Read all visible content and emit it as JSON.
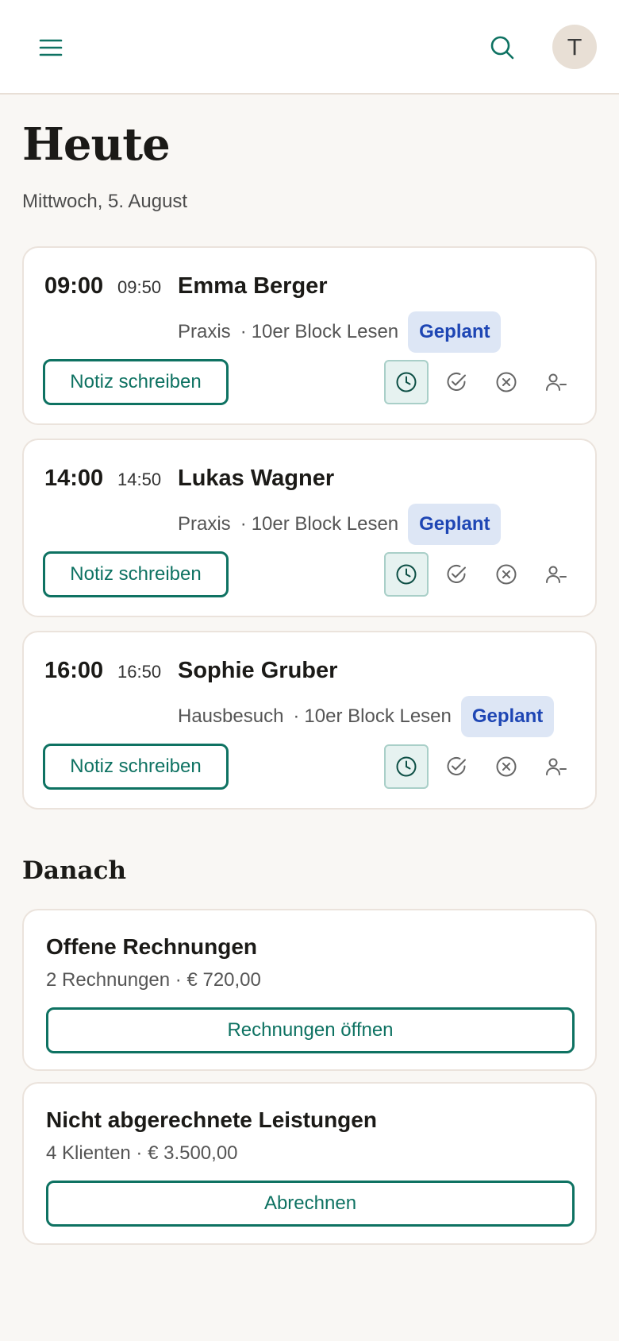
{
  "header": {
    "menu_icon": "menu-icon",
    "search_icon": "search-icon",
    "avatar_initial": "T"
  },
  "page": {
    "title": "Heute",
    "date": "Mittwoch, 5. August"
  },
  "appointments": [
    {
      "start": "09:00",
      "end": "09:50",
      "client": "Emma Berger",
      "location": "Praxis",
      "separator": "·",
      "service": "10er Block Lesen",
      "status": "Geplant",
      "note_label": "Notiz schreiben"
    },
    {
      "start": "14:00",
      "end": "14:50",
      "client": "Lukas Wagner",
      "location": "Praxis",
      "separator": "·",
      "service": "10er Block Lesen",
      "status": "Geplant",
      "note_label": "Notiz schreiben"
    },
    {
      "start": "16:00",
      "end": "16:50",
      "client": "Sophie Gruber",
      "location": "Hausbesuch",
      "separator": "·",
      "service": "10er Block Lesen",
      "status": "Geplant",
      "note_label": "Notiz schreiben"
    }
  ],
  "actions": [
    "clock-icon",
    "check-circle-icon",
    "cancel-circle-icon",
    "user-remove-icon"
  ],
  "later": {
    "title": "Danach",
    "cards": [
      {
        "title": "Offene Rechnungen",
        "subtitle": "2 Rechnungen · € 720,00",
        "button": "Rechnungen öffnen"
      },
      {
        "title": "Nicht abgerechnete Leistungen",
        "subtitle": "4 Klienten · € 3.500,00",
        "button": "Abrechnen"
      }
    ]
  },
  "colors": {
    "accent": "#0e7262",
    "badge_bg": "#dde6f5",
    "badge_text": "#1e46b4",
    "background": "#f9f7f4"
  }
}
